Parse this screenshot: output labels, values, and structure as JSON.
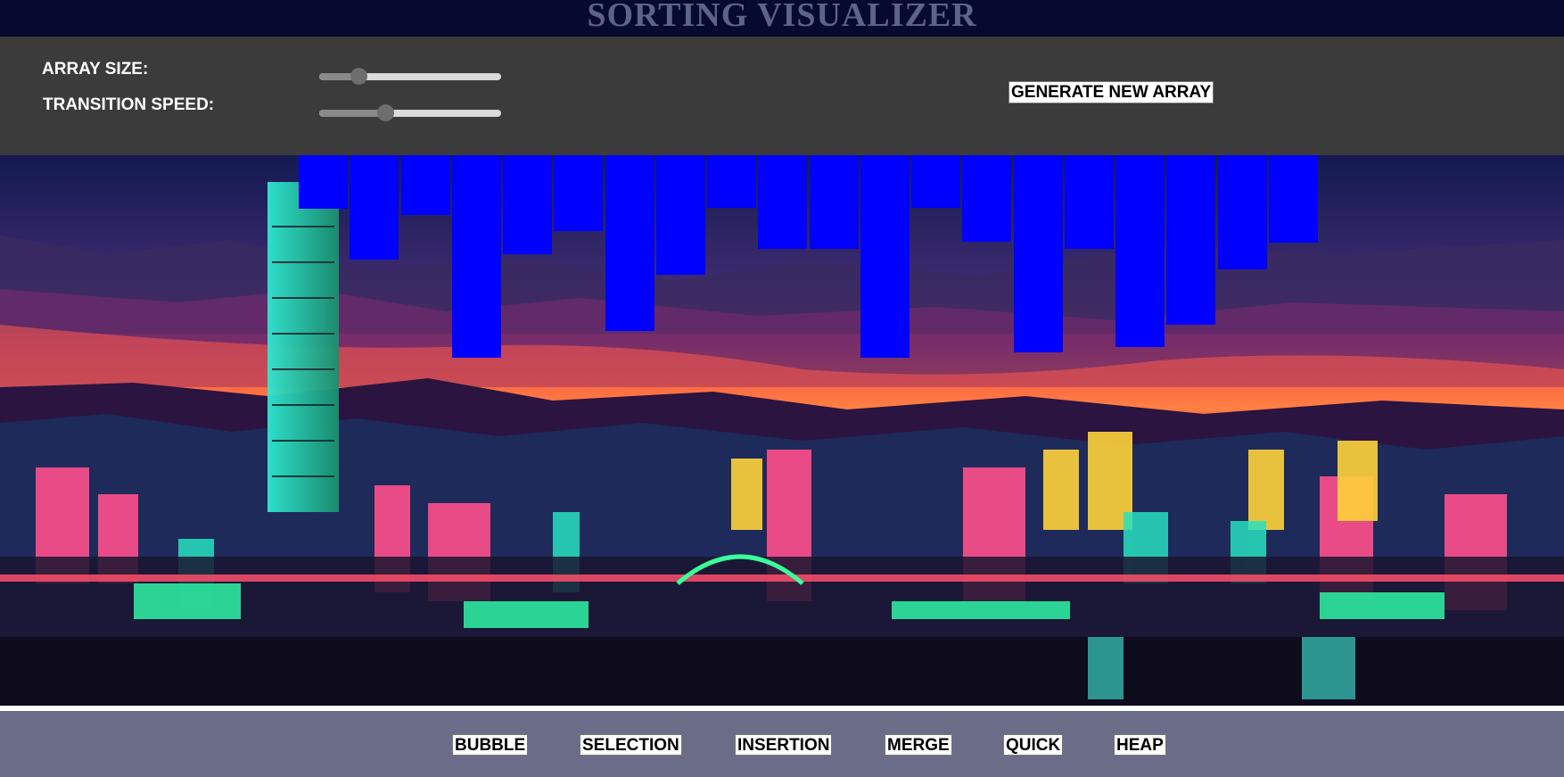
{
  "header": {
    "title": "SORTING VISUALIZER"
  },
  "controls": {
    "array_size_label": "ARRAY SIZE:",
    "speed_label": "TRANSITION SPEED:",
    "array_size_value": 0.19,
    "speed_value": 0.35,
    "generate_label": "GENERATE NEW ARRAY"
  },
  "array": {
    "bar_color": "#0000ff",
    "values": [
      60,
      117,
      67,
      227,
      111,
      85,
      197,
      134,
      59,
      105,
      105,
      227,
      59,
      97,
      221,
      105,
      215,
      190,
      128,
      98
    ]
  },
  "algorithms": {
    "bubble": "BUBBLE",
    "selection": "SELECTION",
    "insertion": "INSERTION",
    "merge": "MERGE",
    "quick": "QUICK",
    "heap": "HEAP"
  },
  "colors": {
    "title_bg": "#050a2e",
    "controls_bg": "#3b3b3b",
    "algo_bar_bg": "#6b6d88"
  }
}
